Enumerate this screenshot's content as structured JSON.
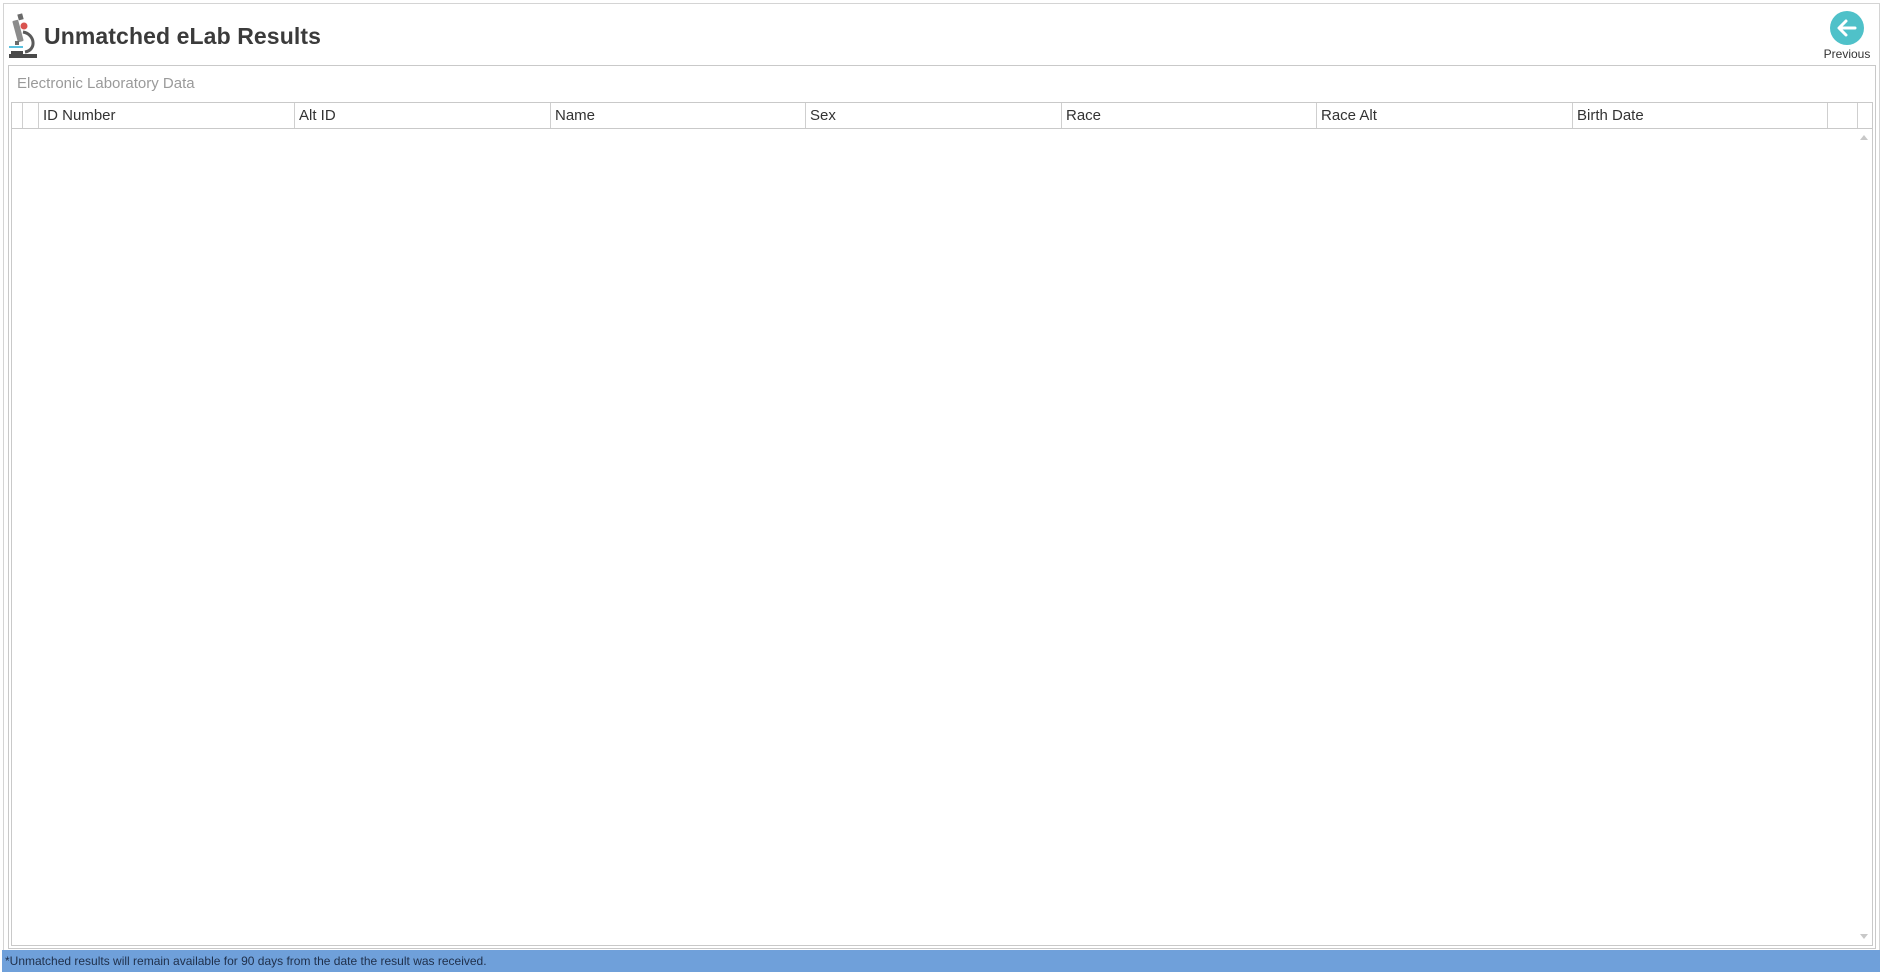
{
  "header": {
    "title": "Unmatched eLab Results",
    "app_icon": "microscope-icon",
    "previous_label": "Previous",
    "previous_icon": "arrow-left-icon",
    "accent_color": "#4fc1c9"
  },
  "panel": {
    "caption": "Electronic Laboratory Data"
  },
  "grid": {
    "columns": [
      "ID Number",
      "Alt ID",
      "Name",
      "Sex",
      "Race",
      "Race Alt",
      "Birth Date"
    ],
    "rows": []
  },
  "status_bar": {
    "text": "*Unmatched results will remain available for 90 days from the date the result was received.",
    "color": "#6fa0da"
  }
}
